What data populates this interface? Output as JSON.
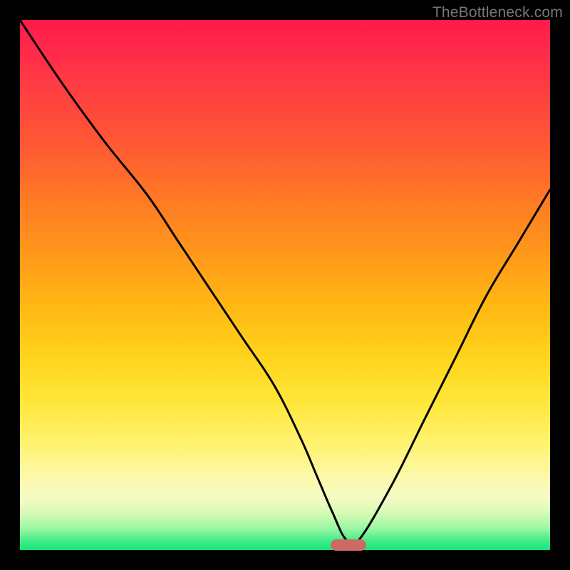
{
  "watermark": "TheBottleneck.com",
  "chart_data": {
    "type": "line",
    "title": "",
    "xlabel": "",
    "ylabel": "",
    "xlim": [
      0,
      100
    ],
    "ylim": [
      0,
      100
    ],
    "grid": false,
    "series": [
      {
        "name": "bottleneck-curve",
        "x": [
          0,
          8,
          16,
          24,
          30,
          36,
          42,
          48,
          53,
          56,
          59,
          61.5,
          64,
          70,
          76,
          82,
          88,
          94,
          100
        ],
        "values": [
          100,
          88,
          77,
          67,
          58,
          49,
          40,
          31,
          21,
          14,
          7,
          2,
          2,
          12,
          24,
          36,
          48,
          58,
          68
        ]
      }
    ],
    "marker": {
      "x": 62,
      "y": 1,
      "label": ""
    },
    "background_gradient": {
      "stops": [
        {
          "pos": 0,
          "color": "#ff1a4b"
        },
        {
          "pos": 50,
          "color": "#ffb814"
        },
        {
          "pos": 80,
          "color": "#fff370"
        },
        {
          "pos": 100,
          "color": "#16e47b"
        }
      ]
    }
  }
}
